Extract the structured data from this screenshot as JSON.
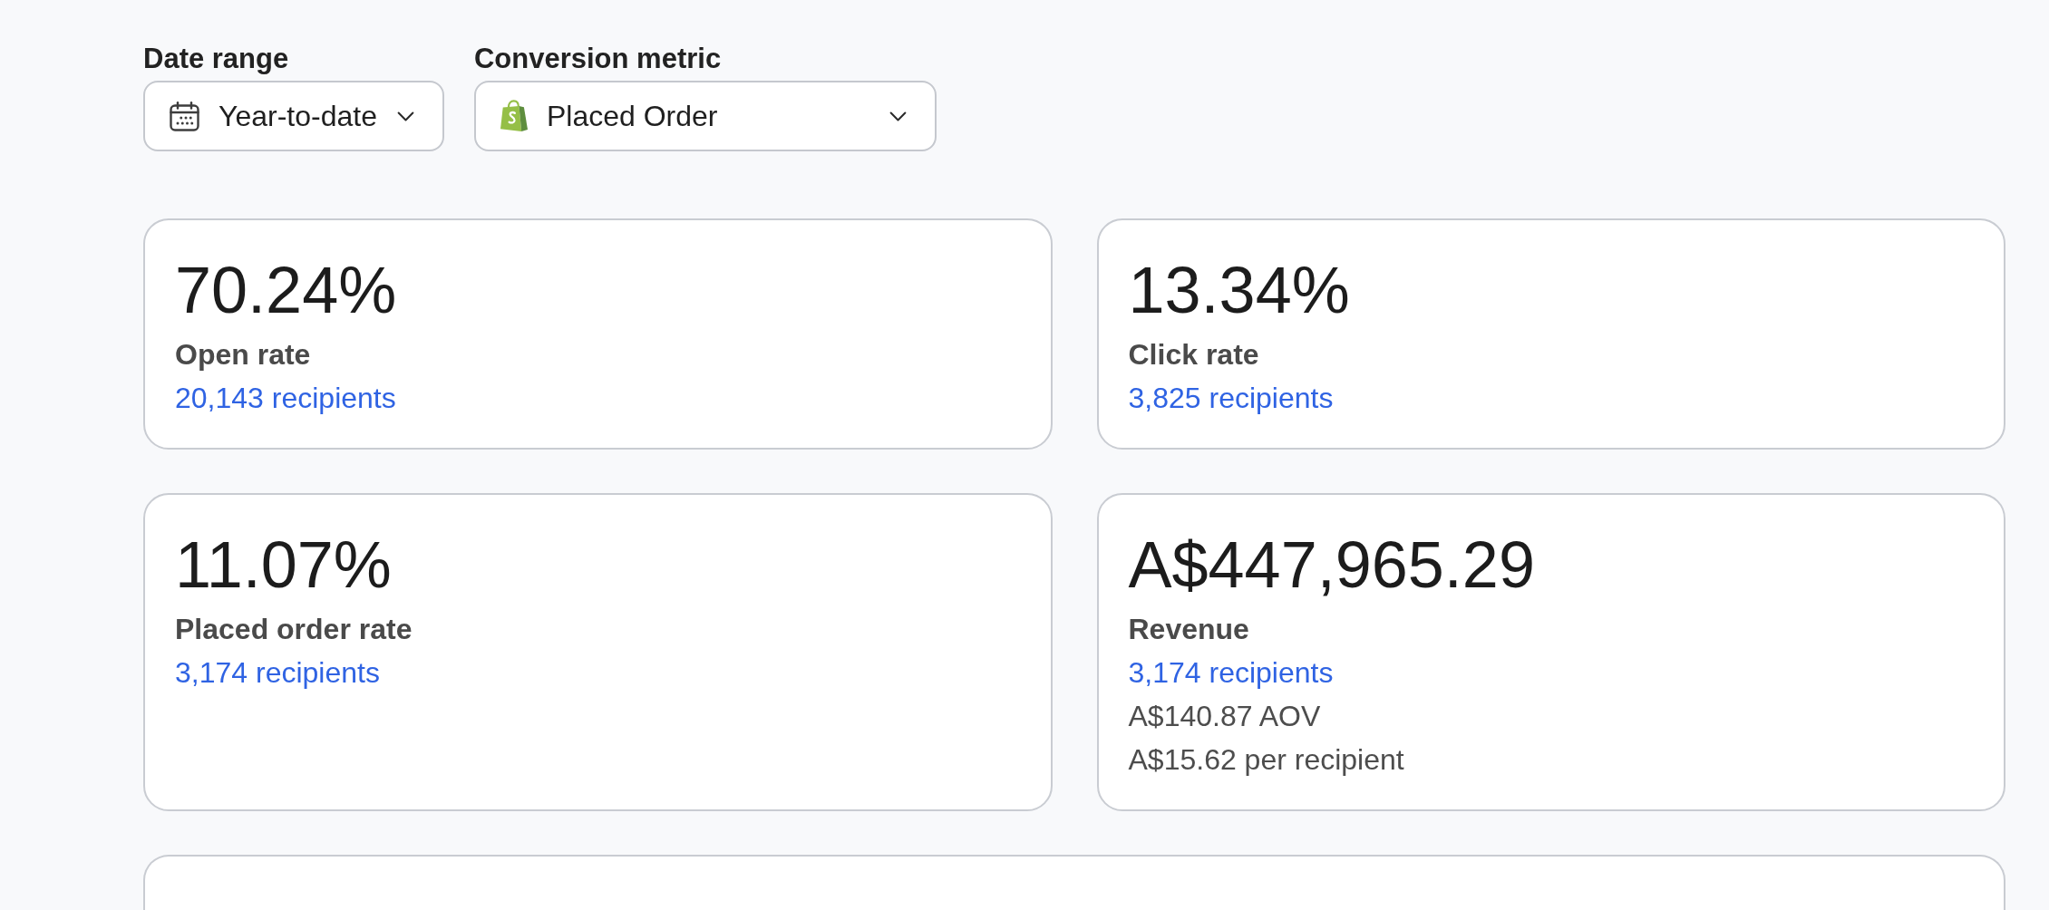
{
  "filters": [
    {
      "kind": "date",
      "label": "Date range",
      "value": "Year-to-date"
    },
    {
      "kind": "metric",
      "label": "Conversion metric",
      "value": "Placed Order"
    }
  ],
  "metrics": [
    {
      "value": "70.24%",
      "label": "Open rate",
      "recipients": "20,143 recipients"
    },
    {
      "value": "13.34%",
      "label": "Click rate",
      "recipients": "3,825 recipients"
    },
    {
      "value": "11.07%",
      "label": "Placed order rate",
      "recipients": "3,174 recipients"
    },
    {
      "value": "A$447,965.29",
      "label": "Revenue",
      "recipients": "3,174 recipients",
      "details": [
        "A$140.87 AOV",
        "A$15.62 per recipient"
      ]
    }
  ]
}
